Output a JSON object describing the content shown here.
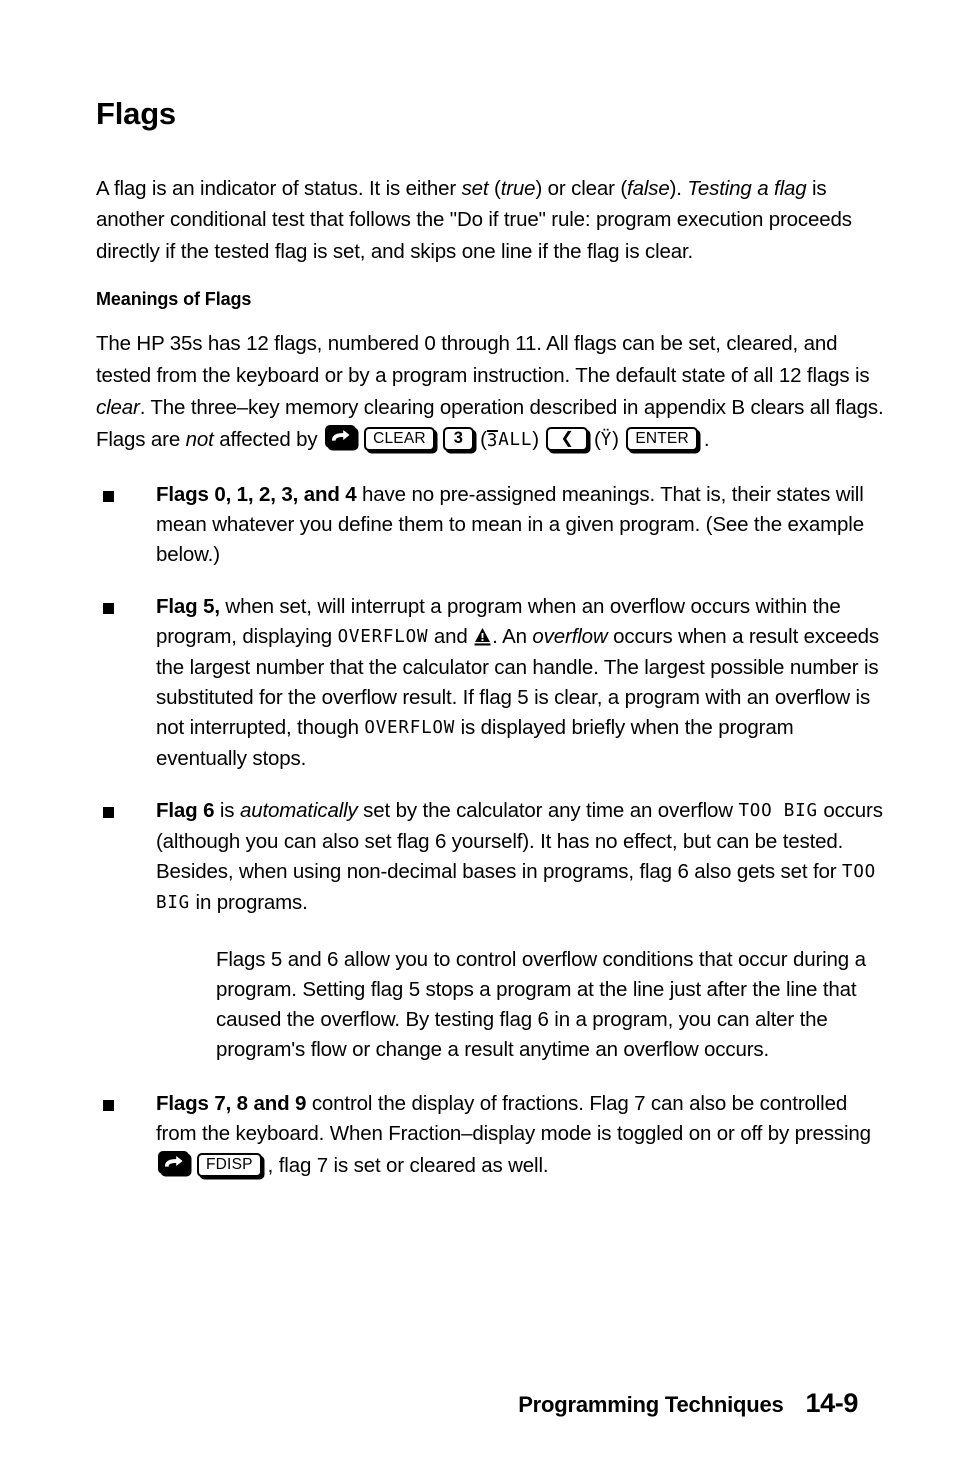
{
  "document": {
    "title": "Flags",
    "intro_paragraph": {
      "seg1": "A flag is an indicator of status. It is either ",
      "em1": "set",
      "seg2": " (",
      "em2": "true",
      "seg3": ") or clear (",
      "em3": "false",
      "seg4": "). ",
      "em4": "Testing a flag",
      "seg5": " is another conditional test that follows the \"Do if true\" rule: program execution proceeds directly if the tested flag is set, and skips one line if the flag is clear."
    },
    "subheading": "Meanings of Flags",
    "meanings_paragraph": {
      "seg1": "The HP 35s has 12 flags, numbered 0 through 11. All flags can be set, cleared, and tested from the keyboard or by a program instruction. The default state of all 12 flags is ",
      "em1": "clear",
      "seg2": ". The three–key memory clearing operation described in appendix B clears all flags. Flags are ",
      "em2": "not",
      "seg3": " affected by ",
      "keys": {
        "shift": "right-shift-key",
        "clear": "CLEAR",
        "three": "3",
        "lcd_3all_over": "3",
        "lcd_3all_rest": "ALL",
        "left_arrow": "❮",
        "lcd_y": "Ÿ",
        "enter": "ENTER"
      },
      "seg_end": "."
    },
    "bullets": [
      {
        "lead": "Flags 0, 1, 2, 3, and 4",
        "text": " have no pre-assigned meanings. That is, their states will mean whatever you define them to mean in a given program. (See the example below.)"
      },
      {
        "lead": "Flag 5,",
        "t1": " when set, will interrupt a program when an overflow occurs within the program, displaying ",
        "lcd1": "OVERFLOW",
        "t2": " and ",
        "icon": "warning-triangle-icon",
        "t3": ". An ",
        "em1": "overflow",
        "t4": " occurs when a result exceeds the largest number that the calculator can handle. The largest possible number is substituted for the overflow result. If flag 5 is clear, a program with an overflow is not interrupted, though ",
        "lcd2": "OVERFLOW",
        "t5": " is displayed briefly when the program eventually stops."
      },
      {
        "lead": "Flag 6",
        "t1": " is ",
        "em1": "automatically",
        "t2": " set by the calculator any time an overflow ",
        "lcd1": "TOO BIG",
        "t3": " occurs (although you can also set flag 6 yourself). It has no effect, but can be tested. Besides, when using non-decimal bases in programs, flag 6 also gets set for ",
        "lcd2": "TOO BIG",
        "t4": " in programs."
      },
      {
        "lead": "Flags 7, 8 and 9",
        "t1": " control the display of fractions. Flag 7 can also be controlled from the keyboard. When Fraction–display mode is toggled on or off by pressing ",
        "key_shift": "right-shift-key",
        "key_fdisp": "FDISP",
        "t2": ", flag 7 is set or cleared as well."
      }
    ],
    "indented_paragraph": "Flags 5 and 6 allow you to control overflow conditions that occur during a program. Setting flag 5 stops a program at the line just after the line that caused the overflow. By testing flag 6 in a program, you can alter the program's flow or change a result anytime an overflow occurs.",
    "footer": {
      "chapter": "Programming Techniques",
      "page": "14-9"
    }
  }
}
